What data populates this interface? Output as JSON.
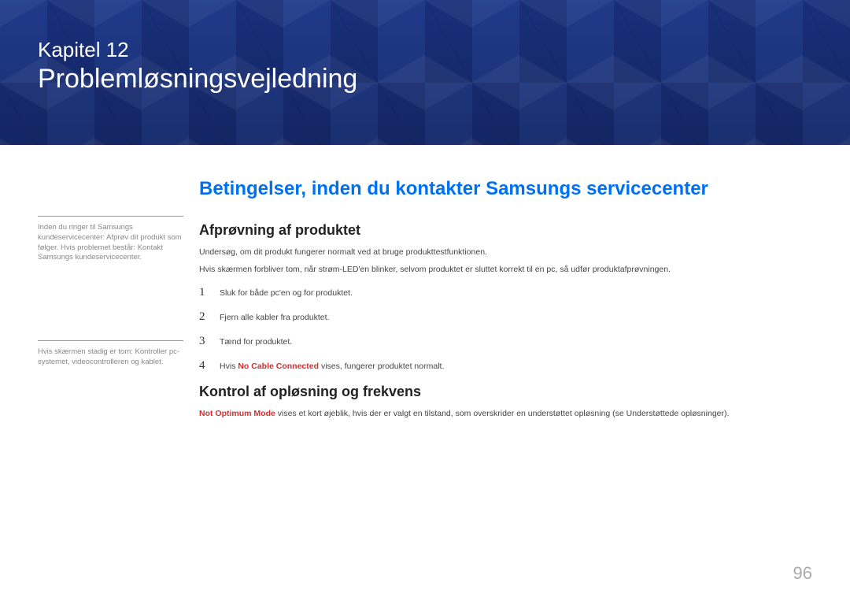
{
  "chapter": {
    "label": "Kapitel  12",
    "title": "Problemløsningsvejledning"
  },
  "sidenotes": {
    "note1": "Inden du ringer til Samsungs kundeservicecenter: Afprøv dit produkt som følger. Hvis problemet består: Kontakt Samsungs kundeservicecenter.",
    "note2": "Hvis skærmen stadig er tom: Kontroller pc-systemet, videocontrolleren og kablet."
  },
  "main": {
    "section_heading": "Betingelser, inden du kontakter Samsungs servicecenter",
    "subsection1": {
      "heading": "Afprøvning af produktet",
      "para1": "Undersøg, om dit produkt fungerer normalt ved at bruge produkttestfunktionen.",
      "para2": "Hvis skærmen forbliver tom, når strøm-LED'en blinker, selvom produktet er sluttet korrekt til en pc, så udfør produktafprøvningen.",
      "steps": [
        "Sluk for både pc'en og for produktet.",
        "Fjern alle kabler fra produktet.",
        "Tænd for produktet."
      ],
      "step4_prefix": "Hvis ",
      "step4_highlight": "No Cable Connected",
      "step4_suffix": " vises, fungerer produktet normalt."
    },
    "subsection2": {
      "heading": "Kontrol af opløsning og frekvens",
      "para_highlight": "Not Optimum Mode",
      "para_suffix": " vises et kort øjeblik, hvis der er valgt en tilstand, som overskrider en understøttet opløsning (se Understøttede opløsninger)."
    }
  },
  "page_number": "96"
}
